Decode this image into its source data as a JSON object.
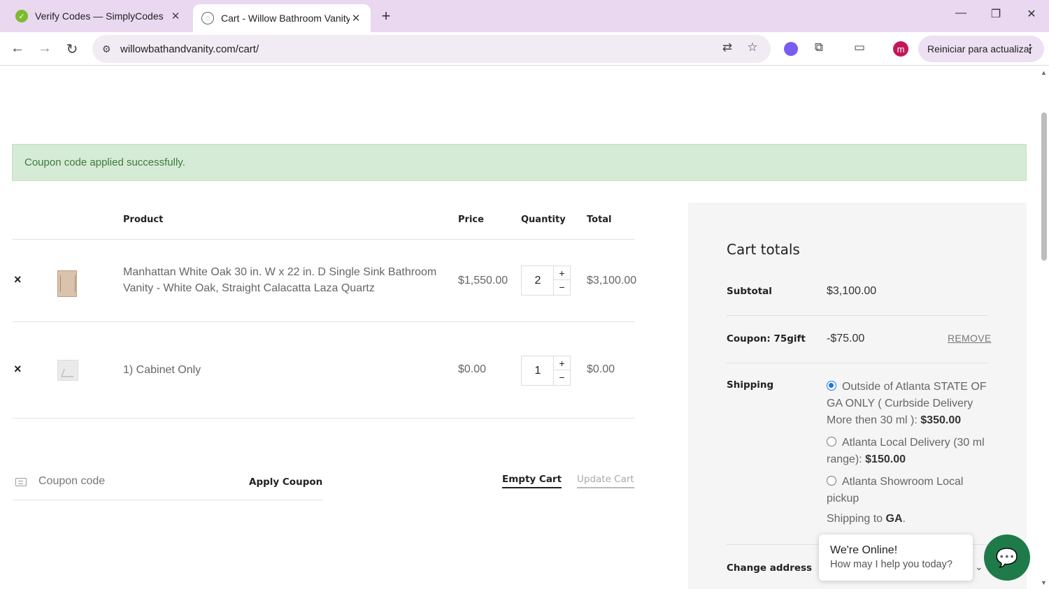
{
  "browser": {
    "tabs": [
      {
        "title": "Verify Codes — SimplyCodes",
        "close": "✕"
      },
      {
        "title": "Cart - Willow Bathroom Vanity",
        "close": "✕"
      }
    ],
    "new_tab": "+",
    "url": "willowbathandvanity.com/cart/",
    "avatar_letter": "m",
    "update_button": "Reiniciar para actualizar",
    "icons": {
      "back": "←",
      "forward": "→",
      "reload": "↻",
      "site_info": "⚙",
      "translate": "⇄",
      "bookmark": "☆",
      "extensions": "⧉",
      "cast": "▭",
      "menu": "⋮",
      "minimize": "—",
      "restore": "❐",
      "close": "✕"
    }
  },
  "notice": {
    "message": "Coupon code applied successfully."
  },
  "cart": {
    "headers": {
      "product": "Product",
      "price": "Price",
      "quantity": "Quantity",
      "total": "Total"
    },
    "items": [
      {
        "remove": "×",
        "name": "Manhattan White Oak 30 in. W x 22 in. D Single Sink Bathroom Vanity - White Oak, Straight Calacatta Laza Quartz",
        "price": "$1,550.00",
        "quantity": "2",
        "total": "$3,100.00"
      },
      {
        "remove": "×",
        "name": "1) Cabinet Only",
        "price": "$0.00",
        "quantity": "1",
        "total": "$0.00"
      }
    ],
    "qty_plus": "+",
    "qty_minus": "−",
    "coupon_placeholder": "Coupon code",
    "apply_coupon": "Apply Coupon",
    "empty_cart": "Empty Cart",
    "update_cart": "Update Cart"
  },
  "totals": {
    "title": "Cart totals",
    "subtotal_label": "Subtotal",
    "subtotal_value": "$3,100.00",
    "coupon_label": "Coupon: 75gift",
    "coupon_value": "-$75.00",
    "remove_label": "REMOVE",
    "shipping_label": "Shipping",
    "shipping_options": [
      {
        "label": "Outside of Atlanta STATE OF GA ONLY ( Curbside Delivery More then 30 ml ):",
        "price": "$350.00",
        "selected": true
      },
      {
        "label": "Atlanta Local Delivery (30 ml range):",
        "price": "$150.00",
        "selected": false
      },
      {
        "label": "Atlanta Showroom Local pickup",
        "price": "",
        "selected": false
      }
    ],
    "ship_to_prefix": "Shipping to",
    "ship_to_state": "GA",
    "ship_to_suffix": ".",
    "change_address": "Change address",
    "chevron": "⌄"
  },
  "chat": {
    "title": "We're Online!",
    "subtitle": "How may I help you today?",
    "icon": "💬"
  }
}
